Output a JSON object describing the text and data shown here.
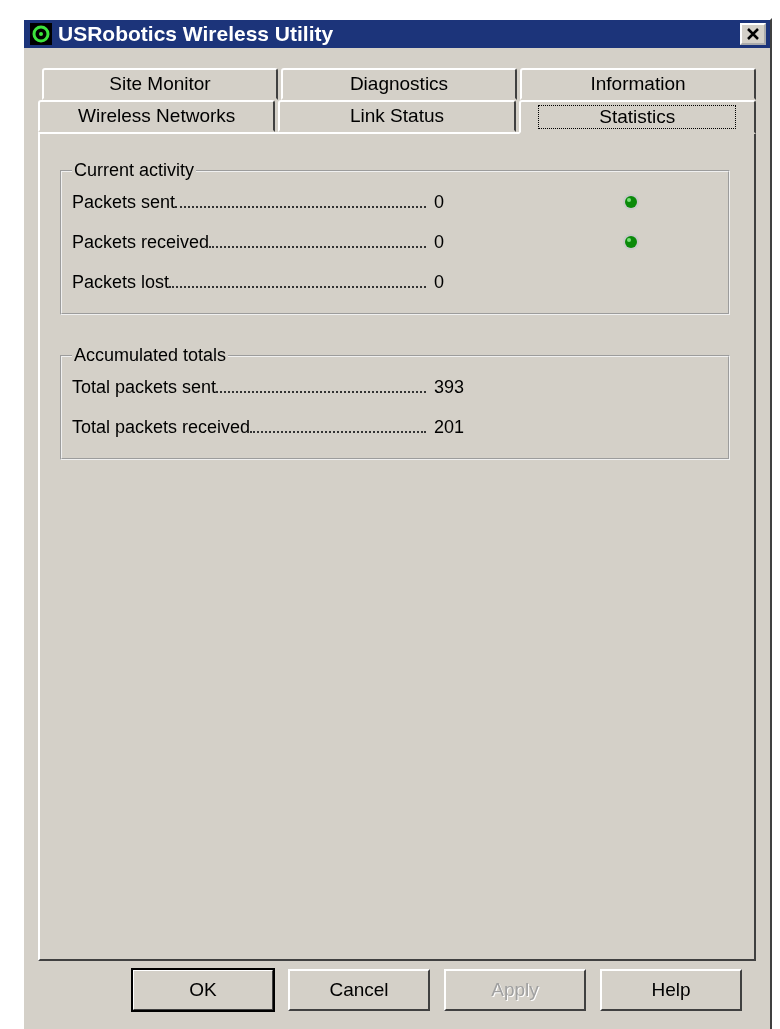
{
  "window": {
    "title": "USRobotics Wireless Utility"
  },
  "tab_rows": [
    {
      "tabs": [
        {
          "label": "Site Monitor",
          "selected": false
        },
        {
          "label": "Diagnostics",
          "selected": false
        },
        {
          "label": "Information",
          "selected": false
        }
      ]
    },
    {
      "tabs": [
        {
          "label": "Wireless Networks",
          "selected": false
        },
        {
          "label": "Link Status",
          "selected": false
        },
        {
          "label": "Statistics",
          "selected": true
        }
      ]
    }
  ],
  "groups": [
    {
      "title": "Current activity",
      "rows": [
        {
          "label": "Packets sent",
          "value": "0",
          "led": true
        },
        {
          "label": "Packets received",
          "value": "0",
          "led": true
        },
        {
          "label": "Packets lost",
          "value": "0",
          "led": false
        }
      ]
    },
    {
      "title": "Accumulated totals",
      "rows": [
        {
          "label": "Total packets sent",
          "value": "393",
          "led": false
        },
        {
          "label": "Total packets received",
          "value": "201",
          "led": false
        }
      ]
    }
  ],
  "buttons": [
    {
      "label": "OK",
      "default": true,
      "disabled": false
    },
    {
      "label": "Cancel",
      "default": false,
      "disabled": false
    },
    {
      "label": "Apply",
      "default": false,
      "disabled": true
    },
    {
      "label": "Help",
      "default": false,
      "disabled": false
    }
  ]
}
